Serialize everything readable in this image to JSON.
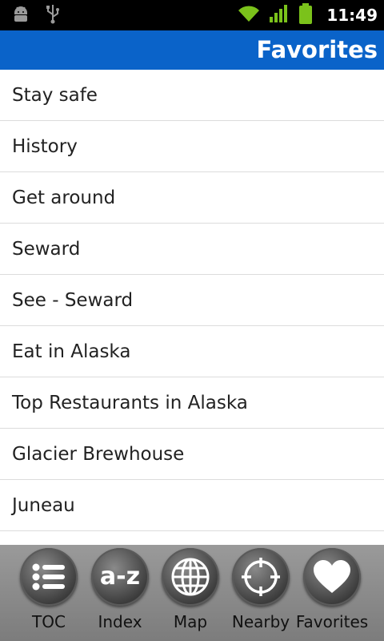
{
  "status_bar": {
    "time": "11:49",
    "icons": [
      "android-debug-icon",
      "usb-icon",
      "wifi-icon",
      "signal-icon",
      "battery-icon"
    ]
  },
  "header": {
    "title": "Favorites",
    "color": "#0a63c9"
  },
  "favorites": [
    "Stay safe",
    "History",
    "Get around",
    "Seward",
    "See - Seward",
    "Eat in Alaska",
    "Top Restaurants in Alaska",
    "Glacier Brewhouse",
    "Juneau",
    ""
  ],
  "bottom_nav": {
    "items": [
      {
        "label": "TOC",
        "icon": "list-icon"
      },
      {
        "label": "Index",
        "icon": "a-z-icon",
        "icon_text": "a-z"
      },
      {
        "label": "Map",
        "icon": "globe-icon"
      },
      {
        "label": "Nearby",
        "icon": "crosshair-icon"
      },
      {
        "label": "Favorites",
        "icon": "heart-icon"
      }
    ]
  }
}
